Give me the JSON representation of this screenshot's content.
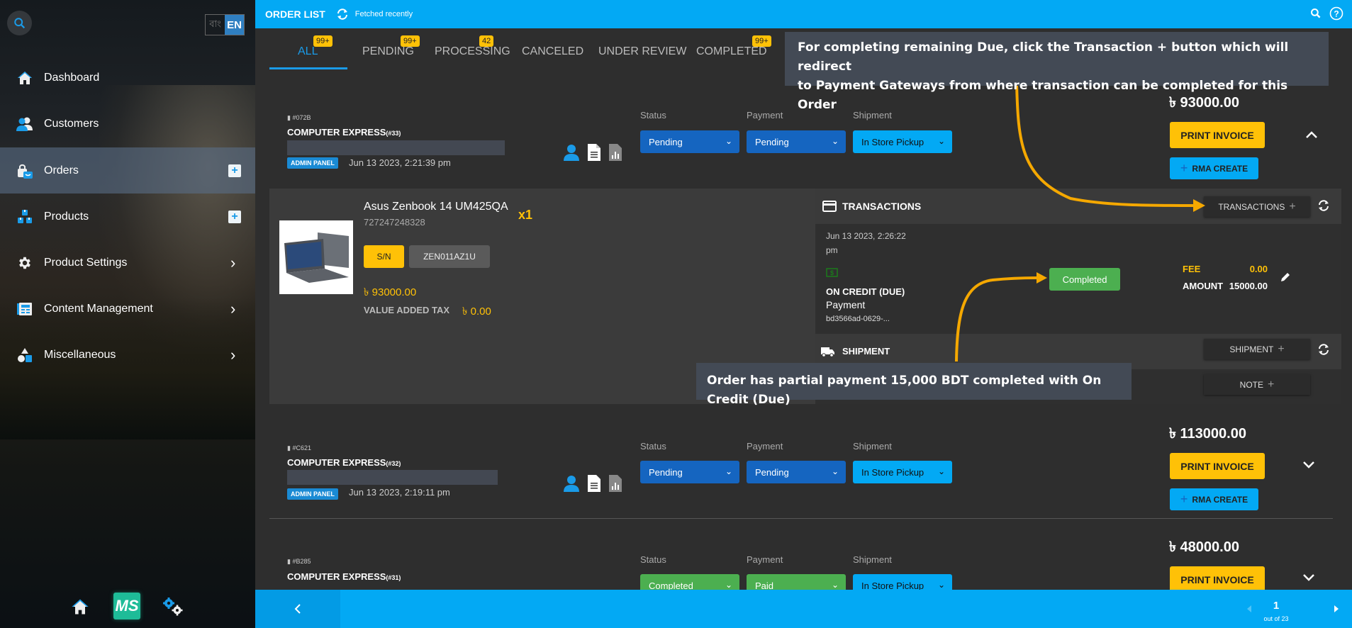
{
  "sidebar": {
    "lang_bn": "বাং",
    "lang_en": "EN",
    "items": [
      {
        "label": "Dashboard",
        "icon": "home-icon"
      },
      {
        "label": "Customers",
        "icon": "customers-icon"
      },
      {
        "label": "Orders",
        "icon": "orders-icon",
        "active": true,
        "action": "+"
      },
      {
        "label": "Products",
        "icon": "products-icon",
        "action": "+"
      },
      {
        "label": "Product Settings",
        "icon": "gear-icon",
        "chevron": "›"
      },
      {
        "label": "Content Management",
        "icon": "content-icon",
        "chevron": "›"
      },
      {
        "label": "Miscellaneous",
        "icon": "shapes-icon",
        "chevron": "›"
      }
    ],
    "bottom": {
      "ms_label": "MS"
    }
  },
  "header": {
    "title": "ORDER LIST",
    "fetched": "Fetched recently"
  },
  "tabs": [
    {
      "label": "ALL",
      "badge": "99+",
      "active": true
    },
    {
      "label": "PENDING",
      "badge": "99+"
    },
    {
      "label": "PROCESSING",
      "badge": "42"
    },
    {
      "label": "CANCELED",
      "badge": ""
    },
    {
      "label": "UNDER REVIEW",
      "badge": ""
    },
    {
      "label": "COMPLETED",
      "badge": "99+"
    }
  ],
  "field_labels": {
    "status": "Status",
    "payment": "Payment",
    "shipment": "Shipment"
  },
  "orders": [
    {
      "id": "#072B",
      "name": "COMPUTER EXPRESS",
      "number": "(#33)",
      "source": "ADMIN PANEL",
      "date": "Jun 13 2023, 2:21:39 pm",
      "status": "Pending",
      "payment": "Pending",
      "shipment": "In Store Pickup",
      "total": "৳ 93000.00",
      "print_label": "PRINT INVOICE",
      "rma_label": "RMA CREATE",
      "expanded": true
    },
    {
      "id": "#C621",
      "name": "COMPUTER EXPRESS",
      "number": "(#32)",
      "source": "ADMIN PANEL",
      "date": "Jun 13 2023, 2:19:11 pm",
      "status": "Pending",
      "payment": "Pending",
      "shipment": "In Store Pickup",
      "total": "৳ 113000.00",
      "print_label": "PRINT INVOICE",
      "rma_label": "RMA CREATE"
    },
    {
      "id": "#B285",
      "name": "COMPUTER EXPRESS",
      "number": "(#31)",
      "status": "Completed",
      "payment": "Paid",
      "shipment": "In Store Pickup",
      "total": "৳ 48000.00",
      "print_label": "PRINT INVOICE"
    }
  ],
  "detail": {
    "product_name": "Asus Zenbook 14 UM425QA",
    "sku": "727247248328",
    "qty": "x1",
    "sn_label": "S/N",
    "sn_value": "ZEN011AZ1U",
    "price": "৳ 93000.00",
    "vat_label": "VALUE ADDED TAX",
    "vat_value": "৳ 0.00",
    "transactions": {
      "title": "TRANSACTIONS",
      "add_label": "TRANSACTIONS",
      "date_line1": "Jun 13 2023, 2:26:22",
      "date_line2": "pm",
      "method": "ON CREDIT (DUE)",
      "type": "Payment",
      "txn_id": "bd3566ad-0629-...",
      "status": "Completed",
      "fee_label": "FEE",
      "fee_value": "0.00",
      "amount_label": "AMOUNT",
      "amount_value": "15000.00"
    },
    "shipment": {
      "title": "SHIPMENT",
      "add_label": "SHIPMENT",
      "note_label": "NOTE"
    }
  },
  "callouts": {
    "top_line1": "For completing remaining Due, click the Transaction + button which will redirect",
    "top_line2": "to Payment Gateways from where transaction can be completed for this Order",
    "bottom": "Order has partial payment 15,000 BDT completed with On Credit (Due)"
  },
  "pagination": {
    "current": "1",
    "total_text": "out of 23"
  },
  "colors": {
    "accent": "#03a9f4",
    "warning": "#ffc107",
    "success": "#4caf50",
    "primary": "#1565c0",
    "annotation": "#f5a800"
  }
}
